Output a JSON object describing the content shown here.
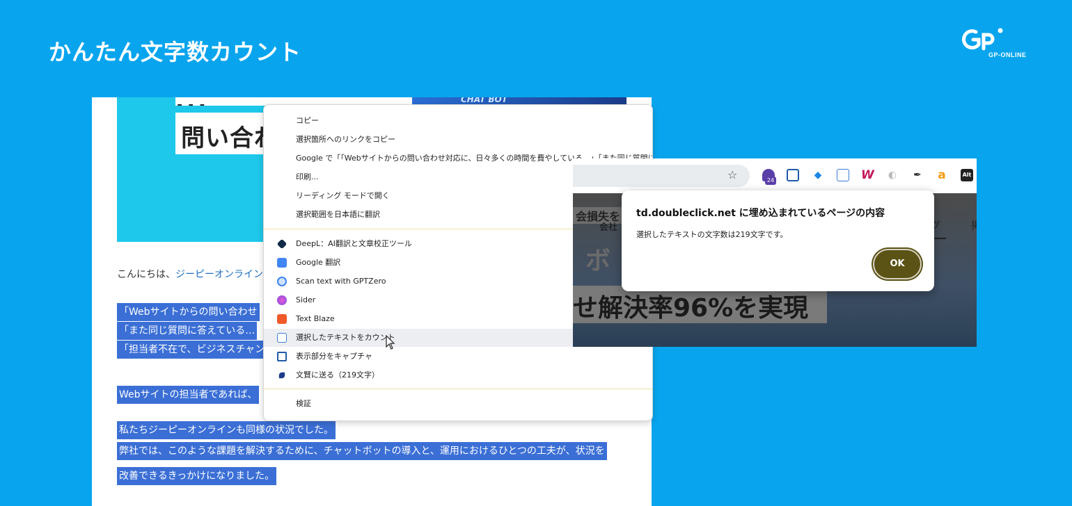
{
  "page": {
    "title": "かんたん文字数カウント",
    "logo_text": "GP-ONLINE"
  },
  "article": {
    "hero_top_line": "...",
    "hero_photo_label": "CHAT BOT",
    "hero_heading": "問い合わ",
    "greeting": "こんにちは、",
    "greeting_link": "ジーピーオンライン",
    "selected_lines": [
      "「Webサイトからの問い合わせ",
      "「また同じ質問に答えている…",
      "「担当者不在で、ビジネスチャン",
      "Webサイトの担当者であれば、",
      "私たちジーピーオンラインも同様の状況でした。",
      "弊社では、このような課題を解決するために、チャットボットの導入と、運用におけるひとつの工夫が、状況を",
      "改善できるきっかけになりました。"
    ]
  },
  "context_menu": {
    "items": [
      {
        "label": "コピー"
      },
      {
        "label": "選択箇所へのリンクをコピー"
      },
      {
        "label": "Google で「「Webサイトからの問い合わせ対応に、日々多くの時間を費やしている…」「また同じ質問に答えている"
      },
      {
        "label": "印刷..."
      },
      {
        "label": "リーディング モードで開く"
      },
      {
        "label": "選択範囲を日本語に翻訳"
      },
      {
        "label": "DeepL：AI翻訳と文章校正ツール",
        "icon": "deepl-icon",
        "color": "#0f2b46"
      },
      {
        "label": "Google 翻訳",
        "icon": "google-translate-icon",
        "color": "#4285f4"
      },
      {
        "label": "Scan text with GPTZero",
        "icon": "gptzero-icon",
        "color": "#3b82f6"
      },
      {
        "label": "Sider",
        "icon": "sider-icon",
        "color": "#9b5de5"
      },
      {
        "label": "Text Blaze",
        "icon": "text-blaze-icon",
        "color": "#f05a28"
      },
      {
        "label": "選択したテキストをカウント",
        "icon": "count-text-icon",
        "color": "#3a7bd5"
      },
      {
        "label": "表示部分をキャプチャ",
        "icon": "capture-icon",
        "color": "#1e5aa8"
      },
      {
        "label": "文賢に送る（219文字）",
        "icon": "bunken-icon",
        "color": "#1e3a8a"
      },
      {
        "label": "検証"
      }
    ]
  },
  "browser": {
    "extension_badge": "24",
    "alt_label": "Alt",
    "amazon_label": "a",
    "w_label": "W",
    "bg_label1": "会損失を",
    "bg_label2": "会社",
    "bg_nav1": "グ",
    "bg_nav2": "掲",
    "bg_big1": "ボ",
    "bg_big2": "せ解決率96%を実現"
  },
  "dialog": {
    "title": "td.doubleclick.net に埋め込まれているページの内容",
    "message": "選択したテキストの文字数は219文字です。",
    "ok_label": "OK"
  }
}
